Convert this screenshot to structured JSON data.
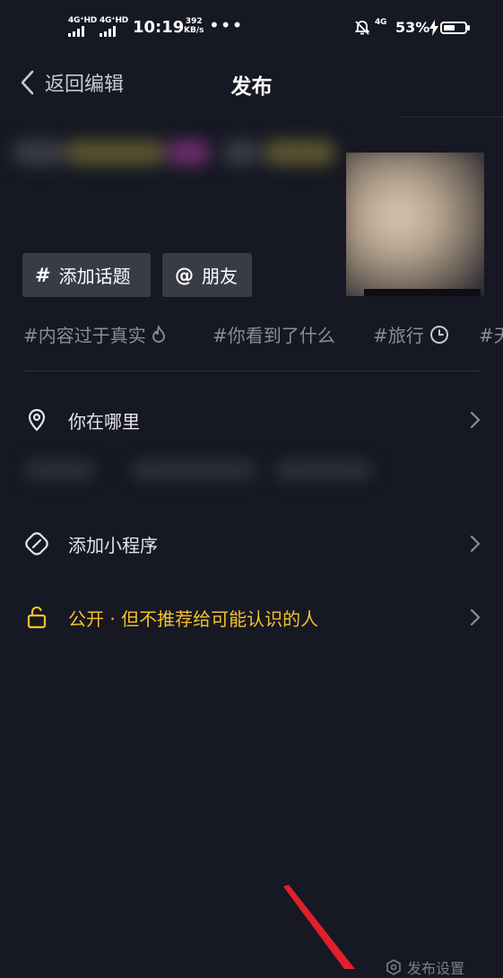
{
  "status_bar": {
    "sim1": "4G⁺HD",
    "sim2": "4G⁺HD",
    "time": "10:19",
    "net_speed_value": "392",
    "net_speed_unit": "KB/s",
    "more": "•••",
    "network": "4G",
    "battery_percent": "53%",
    "icons": [
      "signal-icon",
      "mute-bell-icon",
      "charging-icon",
      "battery-icon"
    ]
  },
  "header": {
    "back_label": "返回编辑",
    "title": "发布"
  },
  "chips": [
    {
      "glyph": "#",
      "label": "添加话题",
      "icon": "hashtag-icon"
    },
    {
      "glyph": "@",
      "label": "朋友",
      "icon": "at-icon"
    }
  ],
  "topics": [
    {
      "label": "#内容过于真实",
      "icon": "fire-icon"
    },
    {
      "label": "#你看到了什么",
      "icon": ""
    },
    {
      "label": "#旅行",
      "icon": "clock-icon"
    },
    {
      "label": "#天",
      "icon": ""
    }
  ],
  "rows": {
    "location": {
      "label": "你在哪里",
      "icon": "location-pin-icon"
    },
    "mini_program": {
      "label": "添加小程序",
      "icon": "link-icon"
    },
    "privacy": {
      "label": "公开 · 但不推荐给可能认识的人",
      "icon": "unlock-icon"
    }
  },
  "footer": {
    "publish_settings": "发布设置",
    "icon": "settings-hexagon-icon"
  },
  "colors": {
    "background": "#161823",
    "chip": "#393b46",
    "privacy_accent": "#f4c02c",
    "annotation_arrow": "#e0202a"
  }
}
